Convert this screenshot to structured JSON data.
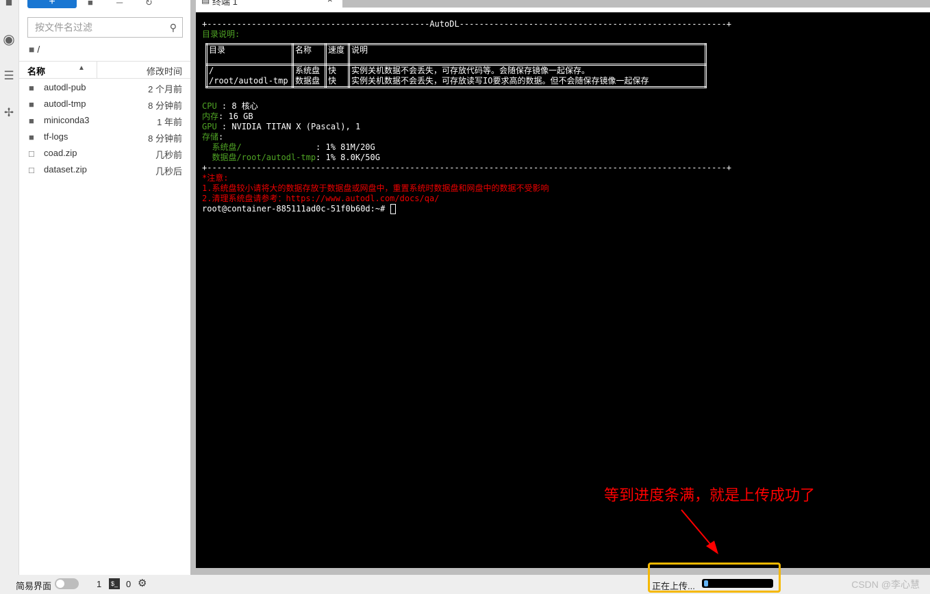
{
  "sidebar_icons": [
    "folder-icon",
    "running-icon",
    "list-icon",
    "extension-icon"
  ],
  "file_browser": {
    "filter_placeholder": "按文件名过滤",
    "path": "/",
    "col_name": "名称",
    "col_modified": "修改时间",
    "items": [
      {
        "name": "autodl-pub",
        "modified": "2 个月前",
        "type": "folder"
      },
      {
        "name": "autodl-tmp",
        "modified": "8 分钟前",
        "type": "folder"
      },
      {
        "name": "miniconda3",
        "modified": "1 年前",
        "type": "folder"
      },
      {
        "name": "tf-logs",
        "modified": "8 分钟前",
        "type": "folder"
      },
      {
        "name": "coad.zip",
        "modified": "几秒前",
        "type": "file"
      },
      {
        "name": "dataset.zip",
        "modified": "几秒后",
        "type": "file"
      }
    ]
  },
  "tab": {
    "label": "终端 1"
  },
  "terminal": {
    "banner": "+---------------------------------------------AutoDL------------------------------------------------------+",
    "dir_title": "目录说明:",
    "table": {
      "headers": [
        "目录",
        "名称",
        "速度",
        "说明"
      ],
      "rows": [
        [
          "/",
          "系统盘",
          "快",
          "实例关机数据不会丢失，可存放代码等。会随保存镜像一起保存。"
        ],
        [
          "/root/autodl-tmp",
          "数据盘",
          "快",
          "实例关机数据不会丢失，可存放读写IO要求高的数据。但不会随保存镜像一起保存"
        ]
      ]
    },
    "cpu_label": "CPU",
    "cpu_value": " : 8 核心",
    "mem_label": "内存",
    "mem_value": ": 16 GB",
    "gpu_label": "GPU",
    "gpu_value": " : NVIDIA TITAN X (Pascal), 1",
    "storage_label": "存储",
    "storage_colon": ":",
    "sys_disk_label": "  系统盘/",
    "sys_disk_value": "               : 1% 81M/20G",
    "data_disk_label": "  数据盘/root/autodl-tmp",
    "data_disk_value": ": 1% 8.0K/50G",
    "divider": "+---------------------------------------------------------------------------------------------------------+",
    "note_title": "*注意:",
    "note_1": "1.系统盘较小请将大的数据存放于数据盘或网盘中，重置系统时数据盘和网盘中的数据不受影响",
    "note_2": "2.清理系统盘请参考：https://www.autodl.com/docs/qa/",
    "prompt": "root@container-885111ad0c-51f0b60d:~# "
  },
  "status_bar": {
    "simple_mode": "简易界面",
    "simple_mode_on": false,
    "kernels": "1",
    "terminals": "0",
    "upload_label": "正在上传...",
    "upload_progress": 0.05,
    "watermark": "CSDN @李心慧"
  },
  "annotation": {
    "text": "等到进度条满，就是上传成功了",
    "color": "#ff0000"
  },
  "colors": {
    "accent": "#1976d2",
    "terminal_green": "#4fa324",
    "terminal_red": "#ee0000",
    "highlight_box": "#f5b800",
    "progress": "#64b5f6"
  }
}
